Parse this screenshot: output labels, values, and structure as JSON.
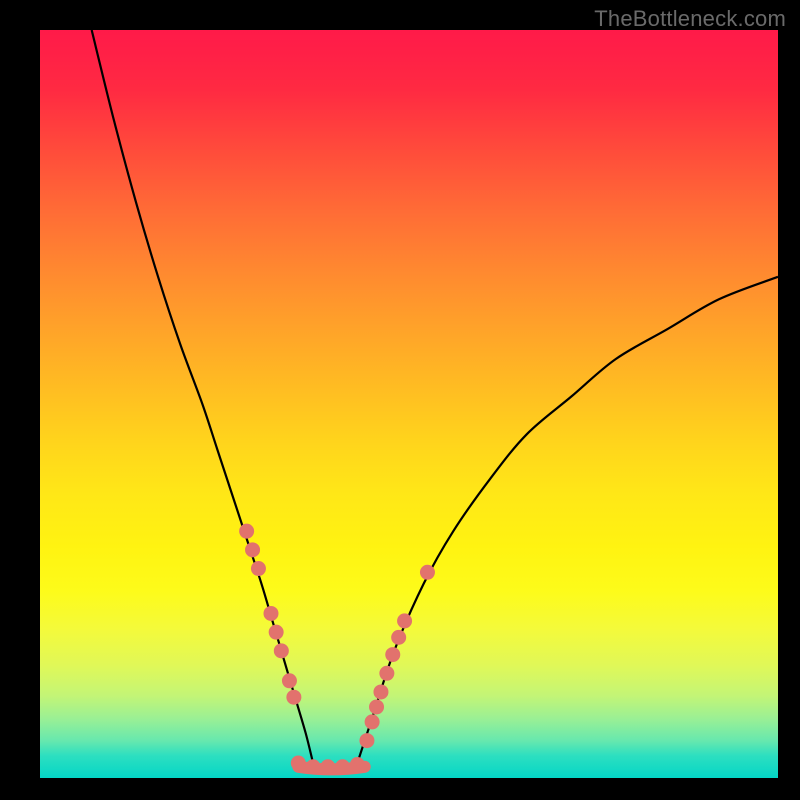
{
  "watermark": "TheBottleneck.com",
  "colors": {
    "background": "#000000",
    "gradient_top": "#ff1a49",
    "gradient_mid": "#ffe717",
    "gradient_bottom": "#04d6c6",
    "curve": "#000000",
    "dots": "#e2726d"
  },
  "chart_data": {
    "type": "line",
    "title": "",
    "xlabel": "",
    "ylabel": "",
    "xlim": [
      0,
      100
    ],
    "ylim": [
      0,
      100
    ],
    "series": [
      {
        "name": "left-curve",
        "x": [
          7,
          10,
          13,
          16,
          19,
          22,
          24,
          26,
          28,
          30,
          31.5,
          33,
          34.5,
          36,
          37
        ],
        "y": [
          100,
          88,
          77,
          67,
          58,
          50,
          44,
          38,
          32,
          26,
          21,
          16,
          11,
          6,
          2
        ]
      },
      {
        "name": "right-curve",
        "x": [
          43,
          45,
          48,
          52,
          56,
          61,
          66,
          72,
          78,
          85,
          92,
          100
        ],
        "y": [
          2,
          8,
          17,
          26,
          33,
          40,
          46,
          51,
          56,
          60,
          64,
          67
        ]
      },
      {
        "name": "plateau",
        "x": [
          35,
          44
        ],
        "y": [
          1.5,
          1.5
        ]
      }
    ],
    "markers": [
      {
        "series": "left",
        "x": 28.0,
        "y": 33.0
      },
      {
        "series": "left",
        "x": 28.8,
        "y": 30.5
      },
      {
        "series": "left",
        "x": 29.6,
        "y": 28.0
      },
      {
        "series": "left",
        "x": 31.3,
        "y": 22.0
      },
      {
        "series": "left",
        "x": 32.0,
        "y": 19.5
      },
      {
        "series": "left",
        "x": 32.7,
        "y": 17.0
      },
      {
        "series": "left",
        "x": 33.8,
        "y": 13.0
      },
      {
        "series": "left",
        "x": 34.4,
        "y": 10.8
      },
      {
        "series": "bottom",
        "x": 35.0,
        "y": 2.0
      },
      {
        "series": "bottom",
        "x": 37.0,
        "y": 1.5
      },
      {
        "series": "bottom",
        "x": 39.0,
        "y": 1.5
      },
      {
        "series": "bottom",
        "x": 41.0,
        "y": 1.5
      },
      {
        "series": "bottom",
        "x": 43.0,
        "y": 1.8
      },
      {
        "series": "right",
        "x": 44.3,
        "y": 5.0
      },
      {
        "series": "right",
        "x": 45.0,
        "y": 7.5
      },
      {
        "series": "right",
        "x": 45.6,
        "y": 9.5
      },
      {
        "series": "right",
        "x": 46.2,
        "y": 11.5
      },
      {
        "series": "right",
        "x": 47.0,
        "y": 14.0
      },
      {
        "series": "right",
        "x": 47.8,
        "y": 16.5
      },
      {
        "series": "right",
        "x": 48.6,
        "y": 18.8
      },
      {
        "series": "right",
        "x": 49.4,
        "y": 21.0
      },
      {
        "series": "right",
        "x": 52.5,
        "y": 27.5
      }
    ],
    "annotations": []
  }
}
